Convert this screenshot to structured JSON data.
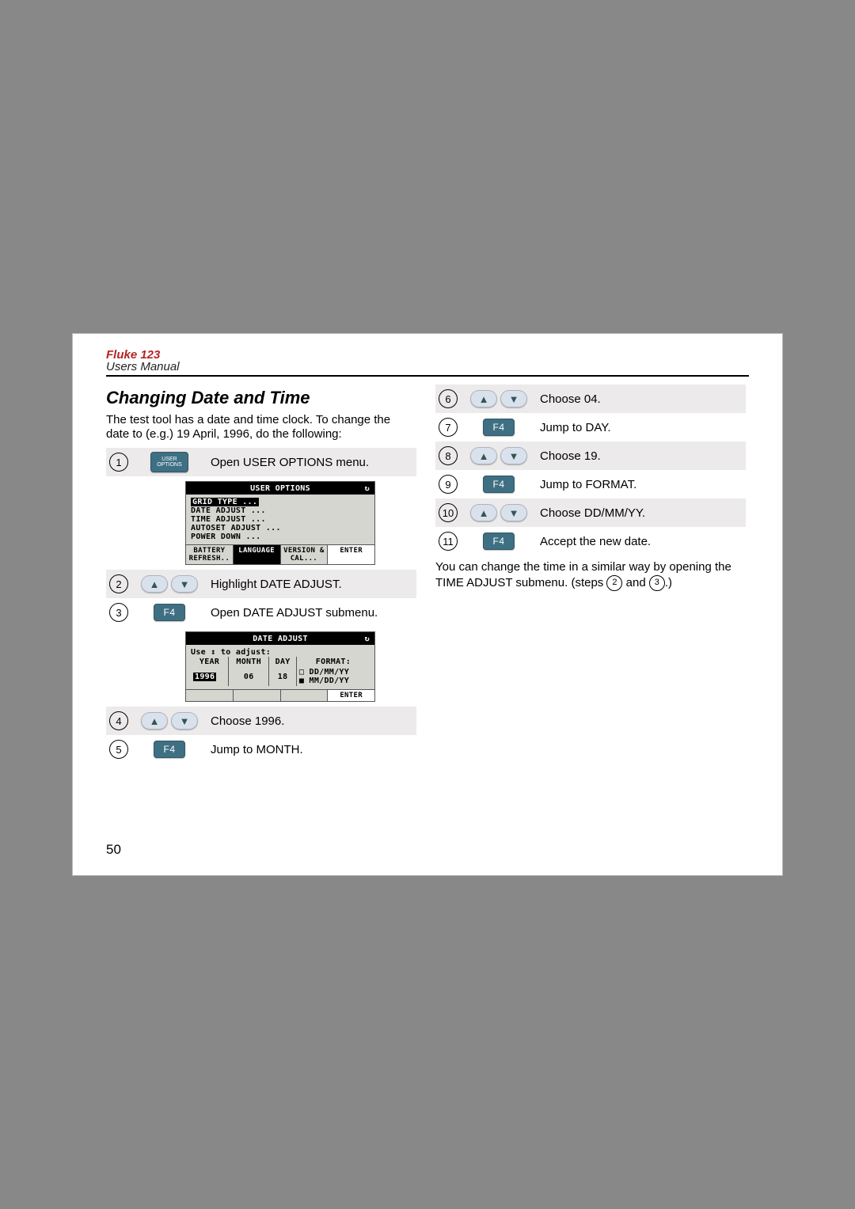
{
  "header": {
    "product": "Fluke 123",
    "sub": "Users Manual"
  },
  "title": "Changing Date and Time",
  "intro": "The test tool has a date and time clock. To change the date to (e.g.) 19 April, 1996, do the following:",
  "page_number": "50",
  "keys": {
    "user_top": "USER",
    "user_bottom": "OPTIONS",
    "f4": "F4",
    "up": "▲",
    "down": "▼"
  },
  "lcd1": {
    "title": "USER OPTIONS",
    "arrow": "↻",
    "items": [
      "GRID TYPE ...",
      "DATE ADJUST ...",
      "TIME ADJUST ...",
      "AUTOSET ADJUST ...",
      "POWER DOWN ..."
    ],
    "soft": [
      "BATTERY REFRESH..",
      "LANGUAGE",
      "VERSION & CAL...",
      "ENTER"
    ]
  },
  "lcd2": {
    "title": "DATE ADJUST",
    "hint": "Use ↕ to adjust:",
    "headers": [
      "YEAR",
      "MONTH",
      "DAY",
      "FORMAT:"
    ],
    "values": [
      "1996",
      "06",
      "18"
    ],
    "format_a": "□ DD/MM/YY",
    "format_b": "■ MM/DD/YY",
    "enter": "ENTER"
  },
  "stepsL": [
    {
      "n": "1",
      "key": "user",
      "text": "Open USER OPTIONS menu.",
      "shade": true
    },
    {
      "n": "2",
      "key": "arrows",
      "text": "Highlight DATE ADJUST.",
      "shade": true
    },
    {
      "n": "3",
      "key": "f4",
      "text": "Open DATE ADJUST submenu.",
      "shade": false
    },
    {
      "n": "4",
      "key": "arrows",
      "text": "Choose 1996.",
      "shade": true
    },
    {
      "n": "5",
      "key": "f4",
      "text": "Jump to  MONTH.",
      "shade": false
    }
  ],
  "stepsR": [
    {
      "n": "6",
      "key": "arrows",
      "text": "Choose 04.",
      "shade": true
    },
    {
      "n": "7",
      "key": "f4",
      "text": "Jump to DAY.",
      "shade": false
    },
    {
      "n": "8",
      "key": "arrows",
      "text": "Choose 19.",
      "shade": true
    },
    {
      "n": "9",
      "key": "f4",
      "text": "Jump to FORMAT.",
      "shade": false
    },
    {
      "n": "10",
      "key": "arrows",
      "text": "Choose DD/MM/YY.",
      "shade": true
    },
    {
      "n": "11",
      "key": "f4",
      "text": "Accept the new date.",
      "shade": false
    }
  ],
  "note_a": "You can change the time in a similar way by opening the TIME ADJUST submenu. (steps ",
  "note_b": " and ",
  "note_c": ".)",
  "note_ref1": "2",
  "note_ref2": "3"
}
